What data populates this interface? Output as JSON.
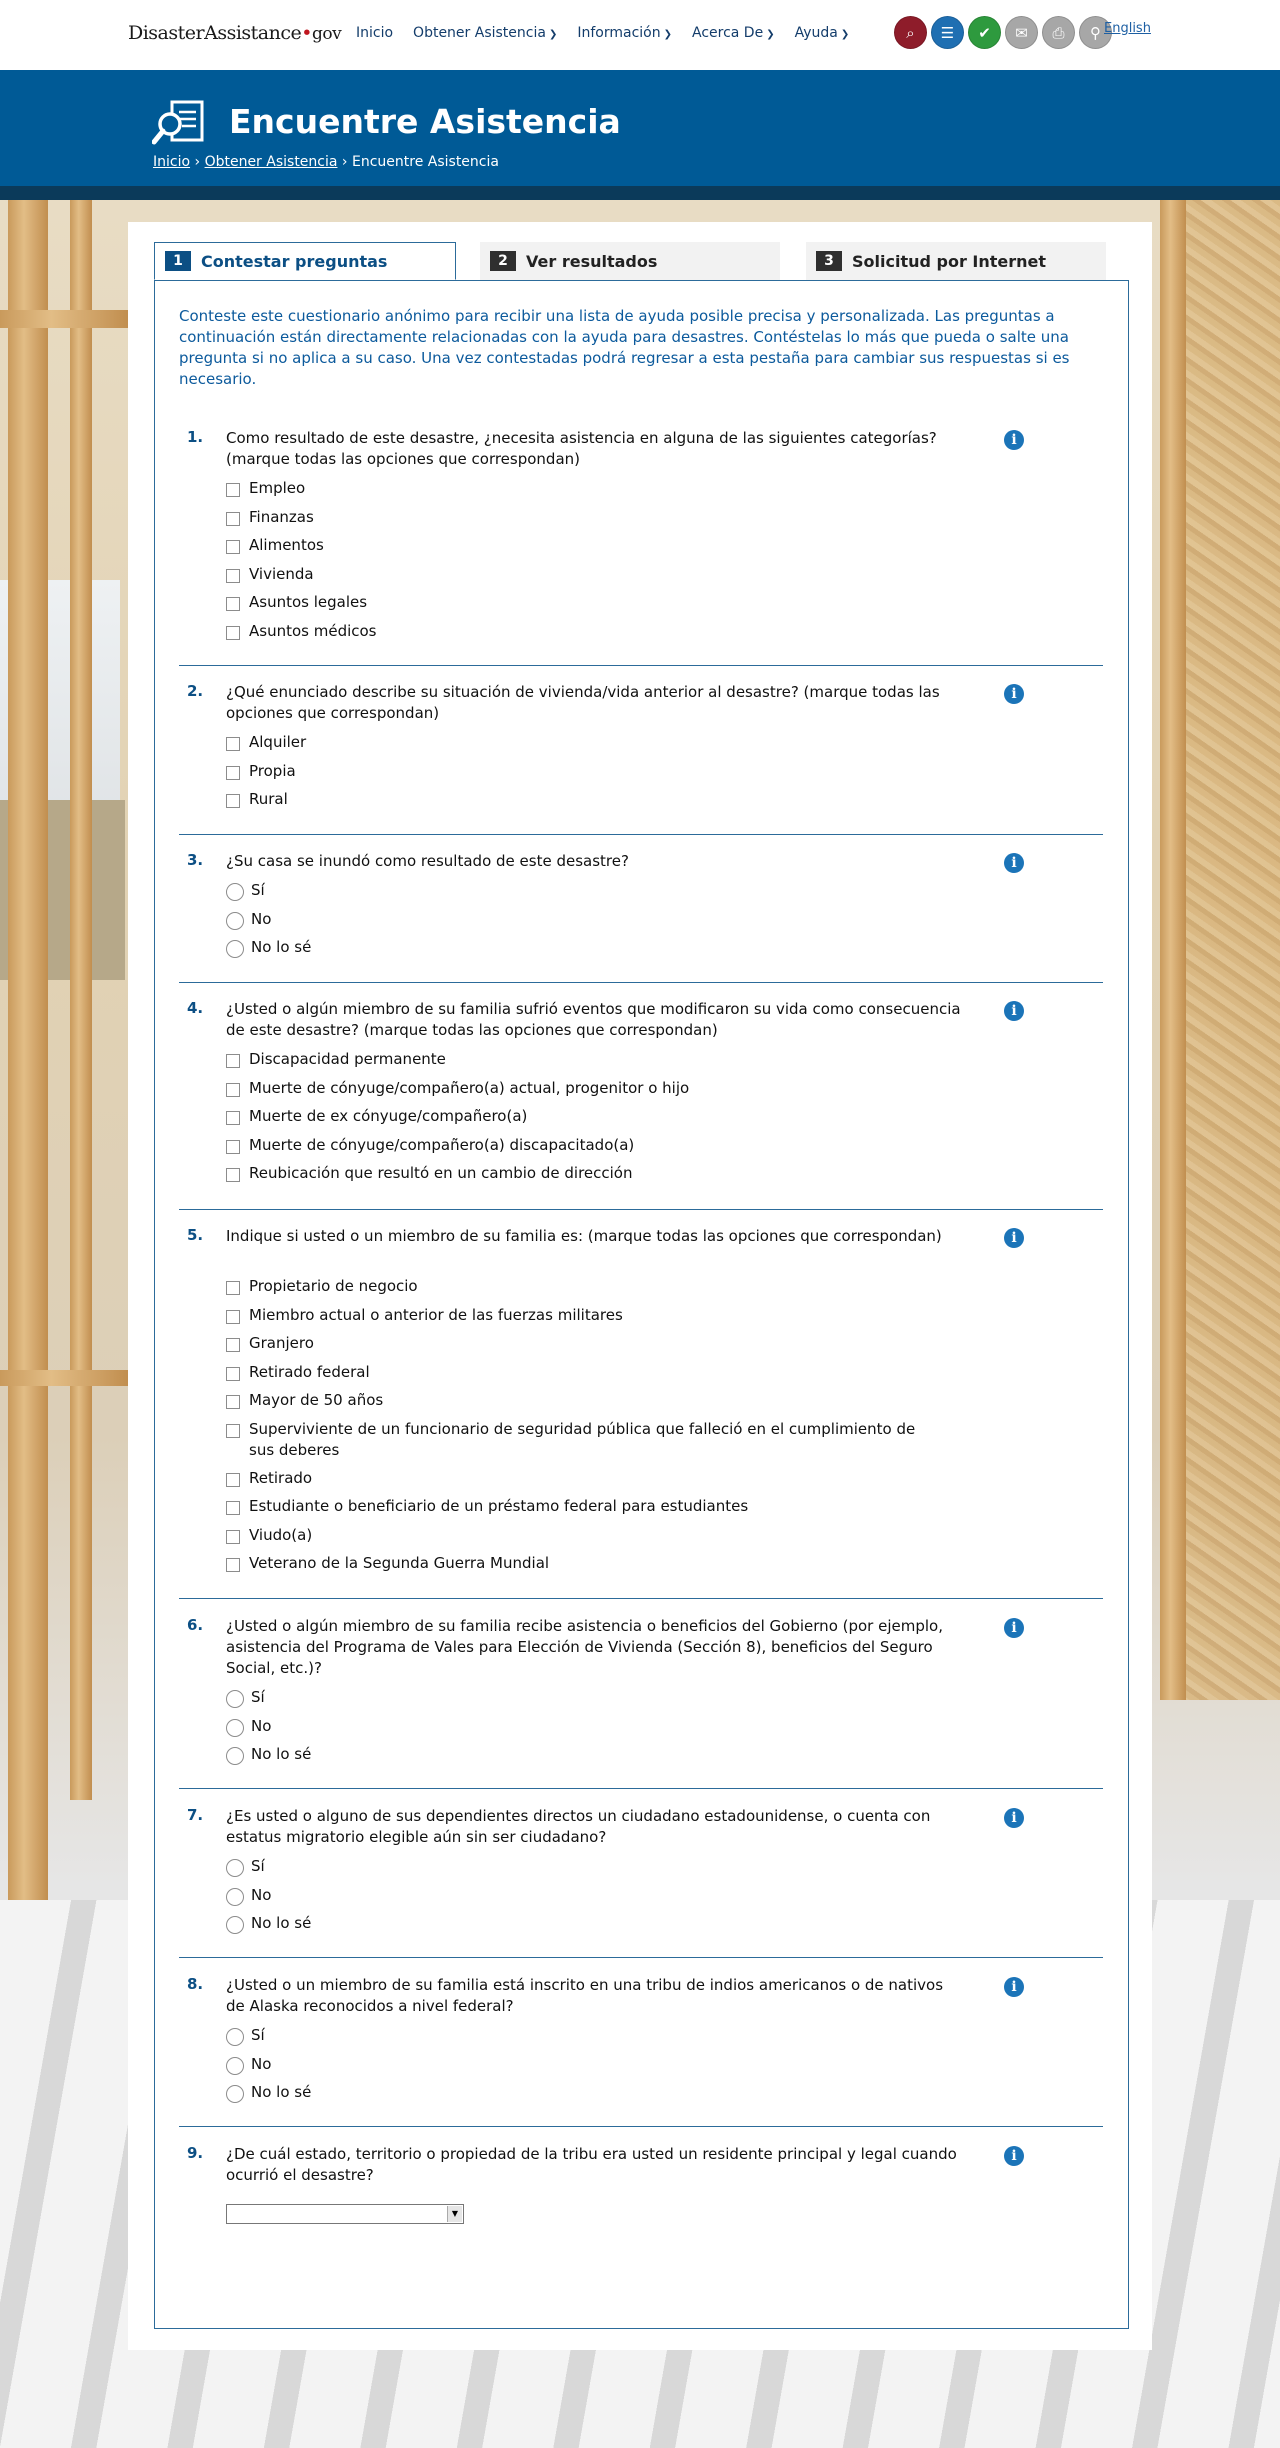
{
  "site": {
    "logo_a": "Disaster",
    "logo_b": "Assistance",
    "logo_dot": "•",
    "logo_gov": "gov",
    "lang": "English"
  },
  "nav": [
    "Inicio",
    "Obtener Asistencia",
    "Información",
    "Acerca De",
    "Ayuda"
  ],
  "tools": [
    {
      "icon": "find-assistance-icon",
      "color": "#8e1c2a"
    },
    {
      "icon": "checklist-icon",
      "color": "#1f6fb2"
    },
    {
      "icon": "check-status-icon",
      "color": "#2e9a3e"
    },
    {
      "icon": "mail-icon",
      "color": "#a7a7a7"
    },
    {
      "icon": "print-icon",
      "color": "#a7a7a7"
    },
    {
      "icon": "search-icon",
      "color": "#a7a7a7"
    }
  ],
  "hero": {
    "title": "Encuentre Asistencia",
    "crumb1": "Inicio",
    "sep": "›",
    "crumb2": "Obtener Asistencia",
    "crumb3": "Encuentre Asistencia"
  },
  "tabs": [
    {
      "num": "1",
      "label": "Contestar preguntas"
    },
    {
      "num": "2",
      "label": "Ver resultados"
    },
    {
      "num": "3",
      "label": "Solicitud por Internet"
    }
  ],
  "intro": "Conteste este cuestionario anónimo para recibir una lista de ayuda posible precisa y personalizada. Las preguntas a continuación están directamente relacionadas con la ayuda para desastres. Contéstelas lo más que pueda o salte una pregunta si no aplica a su caso. Una vez contestadas podrá regresar a esta pestaña para cambiar sus respuestas si es necesario.",
  "info_glyph": "i",
  "select_arrow": "▼",
  "questions": [
    {
      "n": "1.",
      "type": "check",
      "text": "Como resultado de este desastre, ¿necesita asistencia en alguna de las siguientes categorías? (marque todas las opciones que correspondan)",
      "options": [
        "Empleo",
        "Finanzas",
        "Alimentos",
        "Vivienda",
        "Asuntos legales",
        "Asuntos médicos"
      ]
    },
    {
      "n": "2.",
      "type": "check",
      "text": "¿Qué enunciado describe su situación de vivienda/vida anterior al desastre? (marque todas las opciones que correspondan)",
      "options": [
        "Alquiler",
        "Propia",
        "Rural"
      ]
    },
    {
      "n": "3.",
      "type": "radio",
      "text": "¿Su casa se inundó como resultado de este desastre?",
      "options": [
        "Sí",
        "No",
        "No lo sé"
      ]
    },
    {
      "n": "4.",
      "type": "check",
      "text": "¿Usted o algún miembro de su familia sufrió eventos que modificaron su vida como consecuencia de este desastre? (marque todas las opciones que correspondan)",
      "options": [
        "Discapacidad permanente",
        "Muerte de cónyuge/compañero(a) actual, progenitor o hijo",
        "Muerte de ex cónyuge/compañero(a)",
        "Muerte de cónyuge/compañero(a) discapacitado(a)",
        "Reubicación que resultó en un cambio de dirección"
      ]
    },
    {
      "n": "5.",
      "type": "check",
      "text": "Indique si usted o un miembro de su familia es: (marque todas las opciones que correspondan)",
      "options": [
        "Propietario de negocio",
        "Miembro actual o anterior de las fuerzas militares",
        "Granjero",
        "Retirado federal",
        "Mayor de 50 años",
        "Superviviente de un funcionario de seguridad pública que falleció en el cumplimiento de sus deberes",
        "Retirado",
        "Estudiante o beneficiario de un préstamo federal para estudiantes",
        "Viudo(a)",
        "Veterano de la Segunda Guerra Mundial"
      ]
    },
    {
      "n": "6.",
      "type": "radio",
      "text": "¿Usted o algún miembro de su familia recibe asistencia o beneficios del Gobierno (por ejemplo, asistencia del Programa de Vales para Elección de Vivienda (Sección 8), beneficios del Seguro Social, etc.)?",
      "options": [
        "Sí",
        "No",
        "No lo sé"
      ]
    },
    {
      "n": "7.",
      "type": "radio",
      "text": "¿Es usted o alguno de sus dependientes directos un ciudadano estadounidense, o cuenta con estatus migratorio elegible aún sin ser ciudadano?",
      "options": [
        "Sí",
        "No",
        "No lo sé"
      ]
    },
    {
      "n": "8.",
      "type": "radio",
      "text": "¿Usted o un miembro de su familia está inscrito en una tribu de indios americanos o de nativos de Alaska reconocidos a nivel federal?",
      "options": [
        "Sí",
        "No",
        "No lo sé"
      ]
    },
    {
      "n": "9.",
      "type": "select",
      "text": "¿De cuál estado, territorio o propiedad de la tribu era usted un residente principal y legal cuando ocurrió el desastre?",
      "options": [],
      "selected": ""
    }
  ]
}
